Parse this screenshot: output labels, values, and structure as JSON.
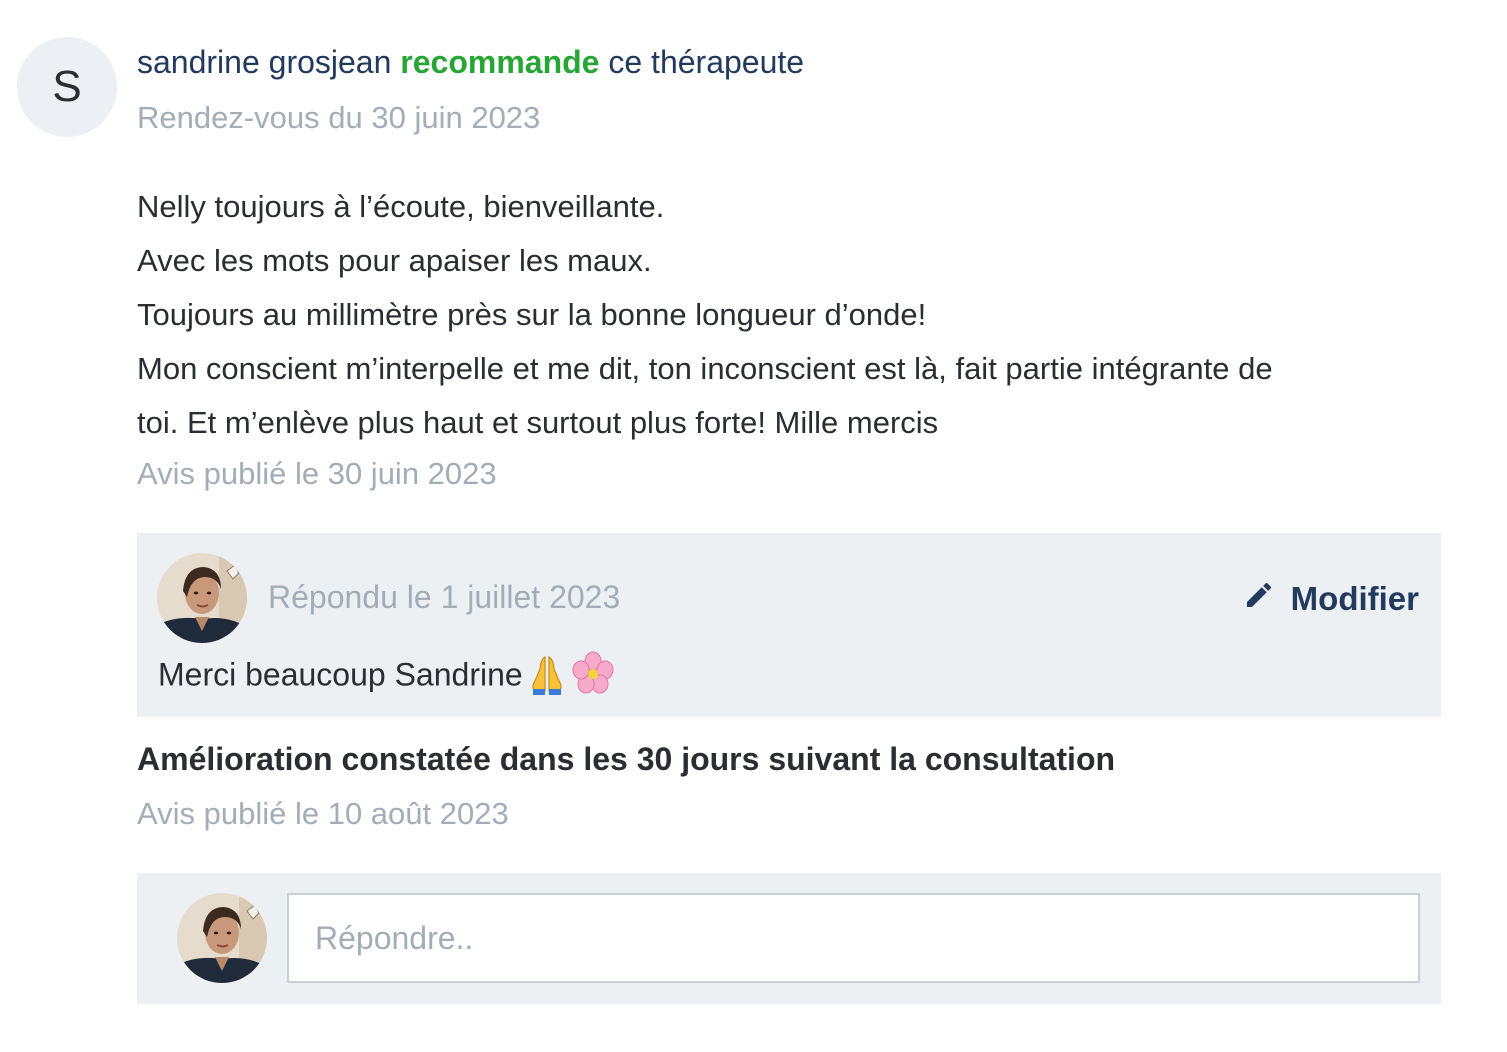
{
  "review": {
    "avatar_letter": "S",
    "author": "sandrine grosjean",
    "recommend_word": "recommande",
    "recommend_suffix": "ce thérapeute",
    "appointment": "Rendez-vous du 30 juin 2023",
    "text_lines": [
      "Nelly toujours à l’écoute, bienveillante.",
      "Avec les mots pour apaiser les maux.",
      "Toujours au millimètre près sur la bonne longueur d’onde!",
      "Mon conscient m’interpelle et me dit, ton inconscient est là, fait partie intégrante de",
      "toi. Et m’enlève plus haut et surtout plus forte! Mille mercis"
    ],
    "published": "Avis publié le 30 juin 2023"
  },
  "reply": {
    "date": "Répondu le 1 juillet 2023",
    "modify_label": "Modifier",
    "text": "Merci beaucoup Sandrine",
    "emojis": [
      "praying-hands-emoji",
      "cherry-blossom-emoji"
    ]
  },
  "followup": {
    "title": "Amélioration constatée dans les 30 jours suivant la consultation",
    "published": "Avis publié le 10 août 2023"
  },
  "answer": {
    "placeholder": "Répondre.."
  },
  "colors": {
    "accent_green": "#27a636",
    "navy": "#223a5e",
    "muted": "#a3adb8",
    "panel_bg": "#edf0f3"
  }
}
